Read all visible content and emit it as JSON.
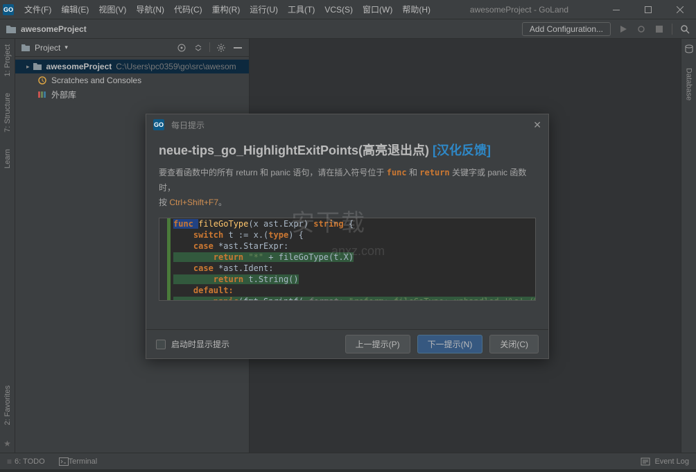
{
  "app": {
    "title": "awesomeProject - GoLand",
    "icon_label": "GO"
  },
  "menu": [
    "文件(F)",
    "编辑(E)",
    "视图(V)",
    "导航(N)",
    "代码(C)",
    "重构(R)",
    "运行(U)",
    "工具(T)",
    "VCS(S)",
    "窗口(W)",
    "帮助(H)"
  ],
  "breadcrumb": "awesomeProject",
  "toolbar": {
    "add_config": "Add Configuration..."
  },
  "left_tabs": [
    "1: Project",
    "7: Structure",
    "Learn"
  ],
  "right_tabs": [
    "Database"
  ],
  "bottom_left_tab": "2: Favorites",
  "project_panel": {
    "title": "Project",
    "tree": {
      "root": "awesomeProject",
      "root_path": "C:\\Users\\pc0359\\go\\src\\awesom",
      "scratches": "Scratches and Consoles",
      "external": "外部库"
    }
  },
  "status": {
    "todo": "6: TODO",
    "terminal": "Terminal",
    "eventlog": "Event Log"
  },
  "dialog": {
    "title": "每日提示",
    "tip_title_a": "neue-tips_go_HighlightExitPoints(高亮退出点)",
    "tip_title_b": "[汉化反馈]",
    "desc_pre": "要查看函数中的所有 return 和 panic 语句，请在插入符号位于 ",
    "desc_func": "func",
    "desc_mid": " 和 ",
    "desc_return": "return",
    "desc_post": " 关键字或 panic 函数时，",
    "desc_press": "按 ",
    "desc_key": "Ctrl+Shift+F7",
    "desc_end": "。",
    "checkbox": "启动时显示提示",
    "prev": "上一提示(P)",
    "next": "下一提示(N)",
    "close": "关闭(C)",
    "code": {
      "l1a": "func ",
      "l1b": "fileGoType",
      "l1c": "(x ast.Expr) ",
      "l1d": "string ",
      "l1e": "{",
      "l2a": "    switch ",
      "l2b": "t := x.(",
      "l2c": "type",
      "l2d": ") {",
      "l3a": "    case ",
      "l3b": "*ast.StarExpr:",
      "l4a": "        return ",
      "l4b": "\"*\"",
      "l4c": " + fileGoType(t.X)",
      "l5a": "    case ",
      "l5b": "*ast.Ident:",
      "l6a": "        return ",
      "l6b": "t.String()",
      "l7a": "    default:",
      "l8a": "        panic",
      "l8b": "(fmt.Sprintf( ",
      "l8c": "format: ",
      "l8d": "\"reform: fileGoType: unhandled '%s' (%"
    }
  },
  "watermark": "安下载",
  "watermark_sm": "anxz.com"
}
